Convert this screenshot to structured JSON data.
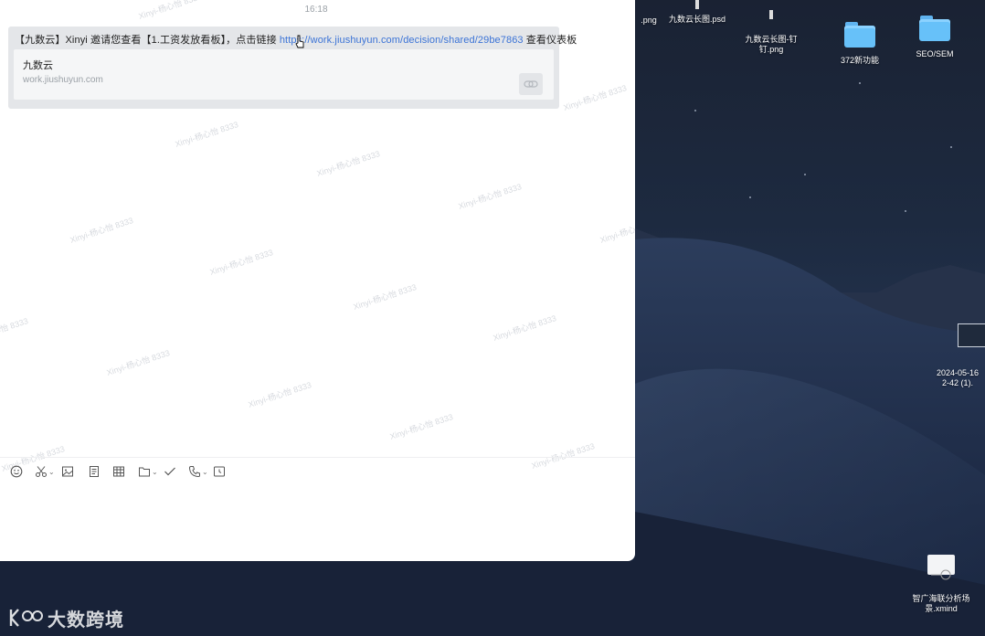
{
  "chat": {
    "timestamp": "16:18",
    "message": {
      "prefix": "【九数云】Xinyi 邀请您查看【1.工资发放看板】，点击链接 ",
      "link": "https://work.jiushuyun.com/decision/shared/29be7863",
      "suffix": " 查看仪表板"
    },
    "preview": {
      "title": "九数云",
      "domain": "work.jiushuyun.com"
    },
    "watermark": "Xinyi-杨心怡 8333",
    "toolbar": {
      "emoji": "emoji-icon",
      "screenshot": "scissors-icon",
      "image": "image-icon",
      "document": "document-icon",
      "table": "table-icon",
      "folder": "folder-icon",
      "task": "checkmark-icon",
      "call": "phone-icon",
      "schedule": "schedule-icon"
    }
  },
  "desktop": {
    "items": [
      {
        "label": ".png"
      },
      {
        "label": "九数云长图.psd"
      },
      {
        "label": "九数云长图-钉\n钉.png"
      },
      {
        "label": "372新功能"
      },
      {
        "label": "SEO/SEM"
      },
      {
        "label": "2024-05-16\n2-42 (1)."
      },
      {
        "label": "智广海联分析场\n景.xmind"
      }
    ]
  },
  "brand": {
    "text": "大数跨境"
  },
  "colors": {
    "link": "#3b73d6",
    "folder": "#67c1f9"
  }
}
